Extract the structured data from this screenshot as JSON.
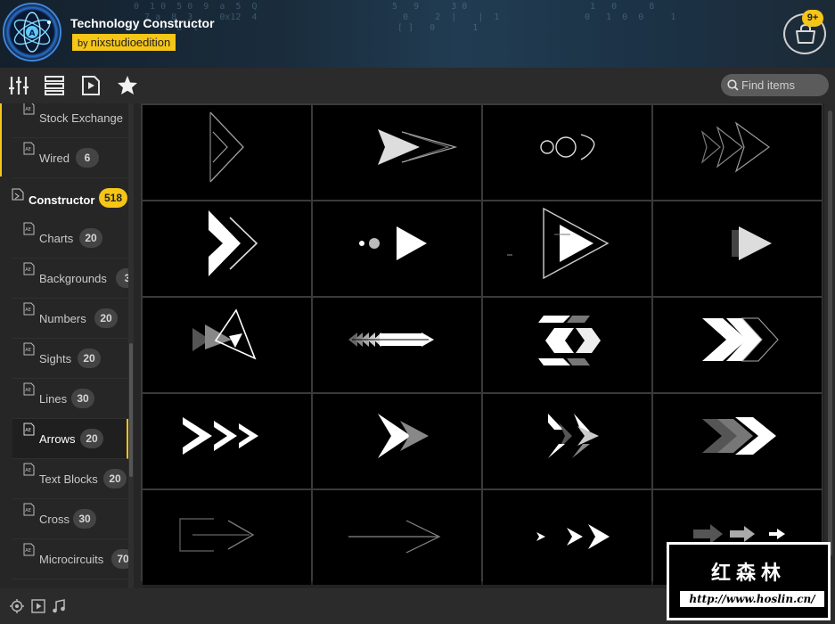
{
  "header": {
    "title": "Technology Constructor",
    "author_prefix": "by",
    "author": "nixstudioedition",
    "cart_badge": "9+"
  },
  "toolbar": {
    "icons": [
      "sliders-icon",
      "list-view-icon",
      "preview-icon",
      "star-icon"
    ],
    "search_placeholder": "Find items"
  },
  "sidebar": {
    "items_above": [
      {
        "label": "Stock Exchange",
        "count": ""
      },
      {
        "label": "Wired",
        "count": "6"
      }
    ],
    "group": {
      "label": "Constructor",
      "count": "518"
    },
    "items": [
      {
        "label": "Charts",
        "count": "20"
      },
      {
        "label": "Backgrounds",
        "count": "3"
      },
      {
        "label": "Numbers",
        "count": "20"
      },
      {
        "label": "Sights",
        "count": "20"
      },
      {
        "label": "Lines",
        "count": "30"
      },
      {
        "label": "Arrows",
        "count": "20",
        "active": true
      },
      {
        "label": "Text Blocks",
        "count": "20"
      },
      {
        "label": "Cross",
        "count": "30"
      },
      {
        "label": "Microcircuits",
        "count": "70"
      }
    ]
  },
  "grid": {
    "columns": 4,
    "rows": 5,
    "thumbnail_style": "arrow-animations"
  },
  "bottombar": {
    "icons": [
      "target-icon",
      "play-box-icon",
      "music-note-icon"
    ]
  },
  "watermark": {
    "chinese": "红森林",
    "url": "http://www.hoslin.cn/"
  },
  "colors": {
    "accent": "#f5c518",
    "background": "#232323",
    "thumb_bg": "#000000"
  }
}
